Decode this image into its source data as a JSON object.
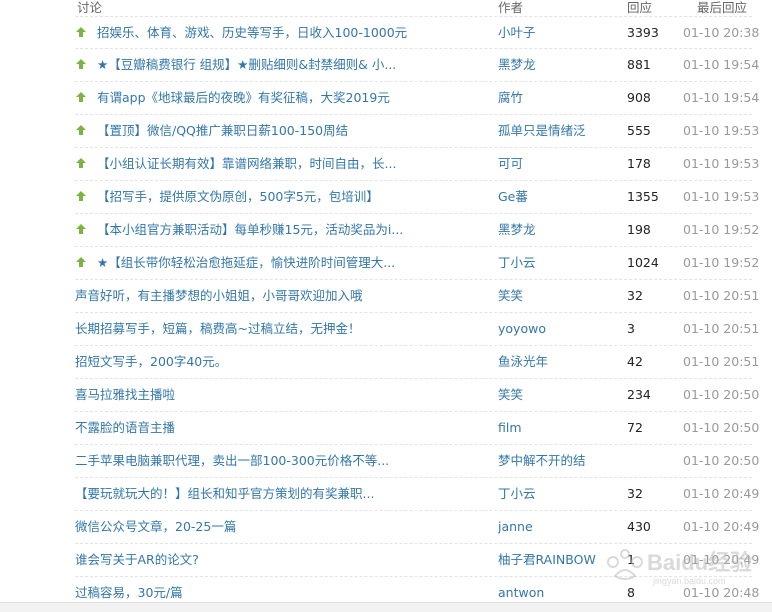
{
  "header": {
    "topic": "讨论",
    "author": "作者",
    "replies": "回应",
    "last_reply": "最后回应"
  },
  "colors": {
    "link": "#3377aa",
    "pin": "#7cb342",
    "time": "#999999"
  },
  "rows": [
    {
      "pinned": true,
      "title": "招娱乐、体育、游戏、历史等写手，日收入100-1000元",
      "author": "小叶子",
      "replies": "3393",
      "time": "01-10 20:38"
    },
    {
      "pinned": true,
      "title": "★【豆瓣稿费银行 组规】★删贴细则&封禁细则& 小...",
      "author": "黑梦龙",
      "replies": "881",
      "time": "01-10 19:54"
    },
    {
      "pinned": true,
      "title": "有谓app《地球最后的夜晚》有奖征稿，大奖2019元",
      "author": "腐竹",
      "replies": "908",
      "time": "01-10 19:54"
    },
    {
      "pinned": true,
      "title": "【置顶】微信/QQ推广兼职日薪100-150周结",
      "author": "孤单只是情绪泛",
      "replies": "555",
      "time": "01-10 19:53"
    },
    {
      "pinned": true,
      "title": "【小组认证长期有效】靠谱网络兼职，时间自由，长...",
      "author": "可可",
      "replies": "178",
      "time": "01-10 19:53"
    },
    {
      "pinned": true,
      "title": "【招写手，提供原文伪原创，500字5元，包培训】",
      "author": "Ge蕃",
      "replies": "1355",
      "time": "01-10 19:53"
    },
    {
      "pinned": true,
      "title": "【本小组官方兼职活动】每单秒赚15元，活动奖品为i...",
      "author": "黑梦龙",
      "replies": "198",
      "time": "01-10 19:52"
    },
    {
      "pinned": true,
      "title": "★【组长带你轻松治愈拖延症，愉快进阶时间管理大...",
      "author": "丁小云",
      "replies": "1024",
      "time": "01-10 19:52"
    },
    {
      "pinned": false,
      "title": "声音好听，有主播梦想的小姐姐，小哥哥欢迎加入哦",
      "author": "笑笑",
      "replies": "32",
      "time": "01-10 20:51"
    },
    {
      "pinned": false,
      "title": "长期招募写手，短篇，稿费高~过稿立结，无押金！",
      "author": "yoyowo",
      "replies": "3",
      "time": "01-10 20:51"
    },
    {
      "pinned": false,
      "title": "招短文写手，200字40元。",
      "author": "鱼泳光年",
      "replies": "42",
      "time": "01-10 20:51"
    },
    {
      "pinned": false,
      "title": "喜马拉雅找主播啦",
      "author": "笑笑",
      "replies": "234",
      "time": "01-10 20:50"
    },
    {
      "pinned": false,
      "title": "不露脸的语音主播",
      "author": "film",
      "replies": "72",
      "time": "01-10 20:50"
    },
    {
      "pinned": false,
      "title": "二手苹果电脑兼职代理，卖出一部100-300元价格不等...",
      "author": "梦中解不开的结",
      "replies": "",
      "time": "01-10 20:50"
    },
    {
      "pinned": false,
      "title": "【要玩就玩大的！】组长和知乎官方策划的有奖兼职...",
      "author": "丁小云",
      "replies": "32",
      "time": "01-10 20:49"
    },
    {
      "pinned": false,
      "title": "微信公众号文章，20-25一篇",
      "author": "janne",
      "replies": "430",
      "time": "01-10 20:49"
    },
    {
      "pinned": false,
      "title": "谁会写关于AR的论文?",
      "author": "柚子君RAINBOW",
      "replies": "1",
      "time": "01-10 20:49"
    },
    {
      "pinned": false,
      "title": "过稿容易，30元/篇",
      "author": "antwon",
      "replies": "8",
      "time": "01-10 20:48"
    }
  ],
  "watermark": {
    "text": "Baidu经验",
    "subtext": "jingyan.baidu.com"
  }
}
